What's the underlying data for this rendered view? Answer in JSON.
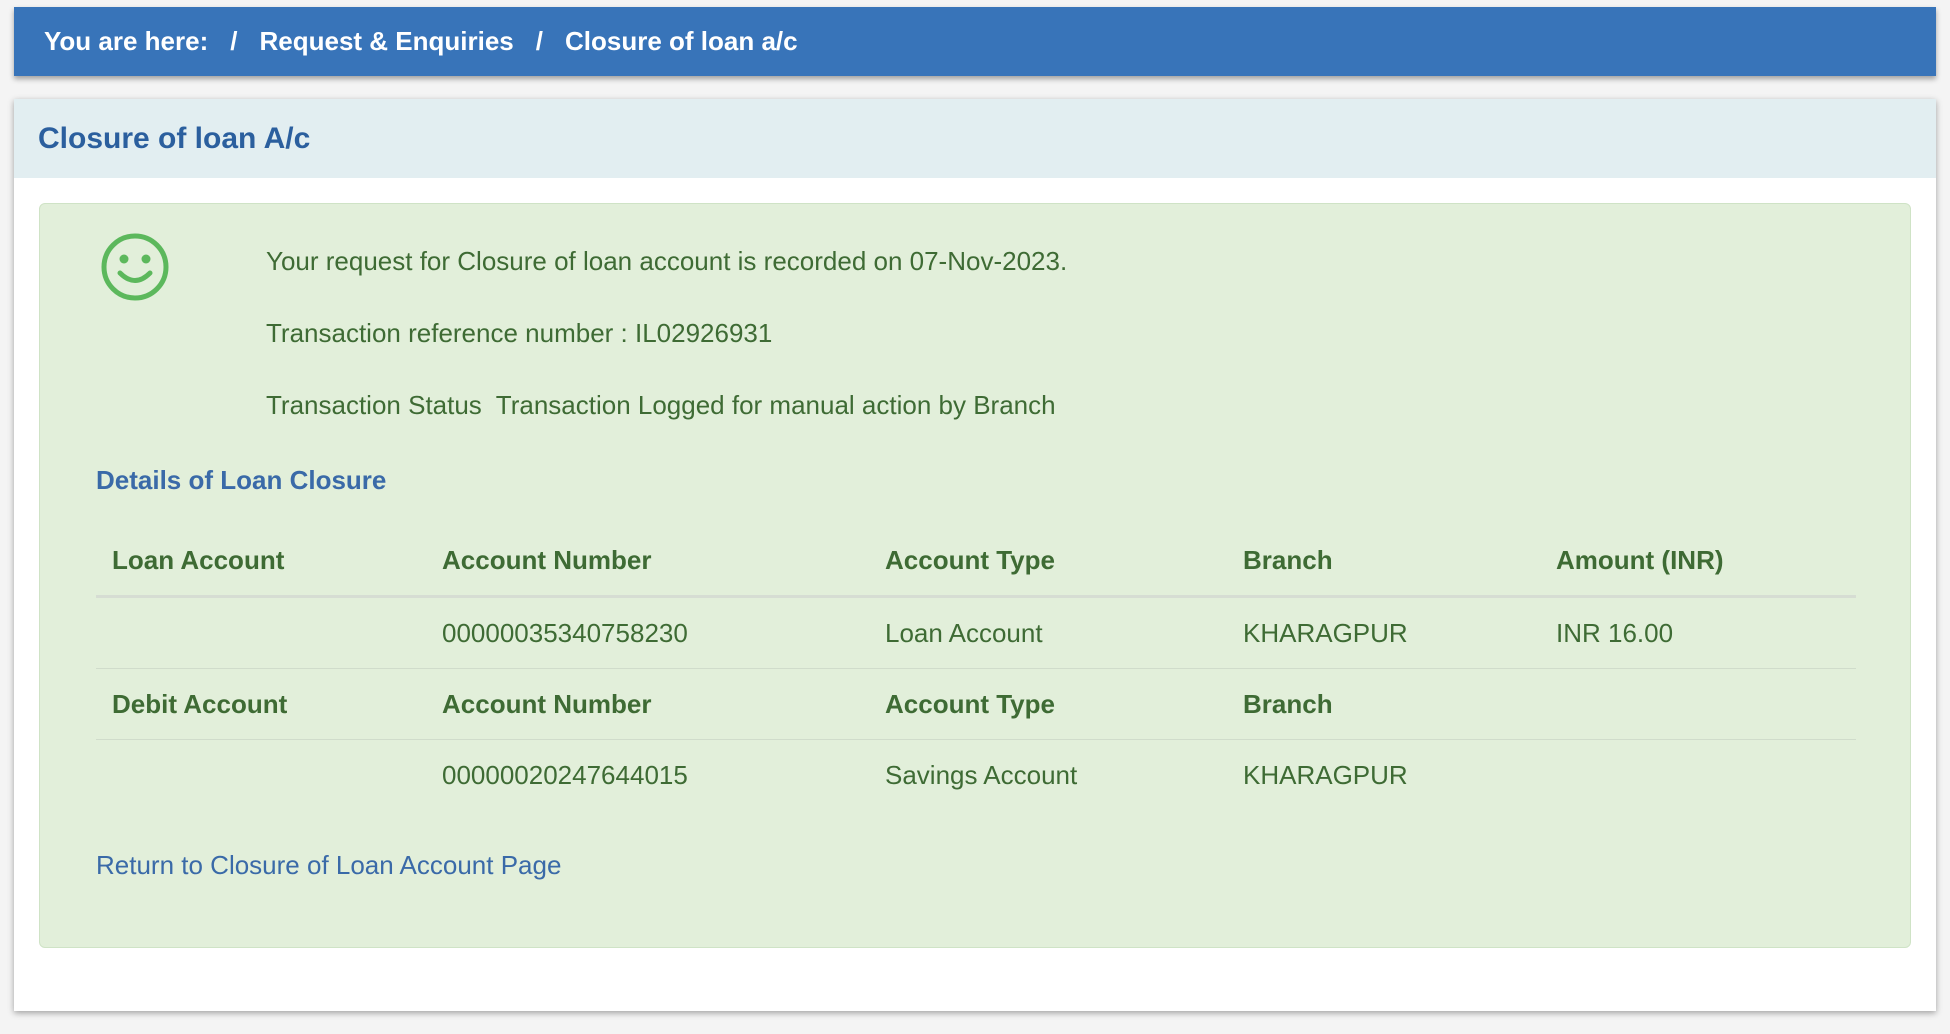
{
  "breadcrumb": {
    "prefix": "You are here:",
    "separator": "/",
    "items": [
      "Request & Enquiries",
      "Closure of loan a/c"
    ]
  },
  "page": {
    "title": "Closure of loan A/c"
  },
  "result": {
    "icon": "smiley-face-icon",
    "recorded_message": "Your request for Closure of loan account is recorded on 07-Nov-2023.",
    "reference_message": "Transaction reference number : IL02926931",
    "status_message": "Transaction Status  Transaction Logged for manual action by Branch"
  },
  "details": {
    "heading": "Details of Loan Closure",
    "loan": {
      "label": "Loan Account",
      "headers": [
        "Account Number",
        "Account Type",
        "Branch",
        "Amount (INR)"
      ],
      "values": [
        "00000035340758230",
        "Loan Account",
        "KHARAGPUR",
        "INR 16.00"
      ]
    },
    "debit": {
      "label": "Debit Account",
      "headers": [
        "Account Number",
        "Account Type",
        "Branch"
      ],
      "values": [
        "00000020247644015",
        "Savings Account",
        "KHARAGPUR"
      ]
    }
  },
  "actions": {
    "return_link": "Return to Closure of Loan Account Page"
  },
  "colors": {
    "breadcrumb_bg": "#3874b9",
    "header_bg": "#e2eef1",
    "success_bg": "#e2efda",
    "success_text": "#3e6b34",
    "link": "#3a6aa8"
  }
}
